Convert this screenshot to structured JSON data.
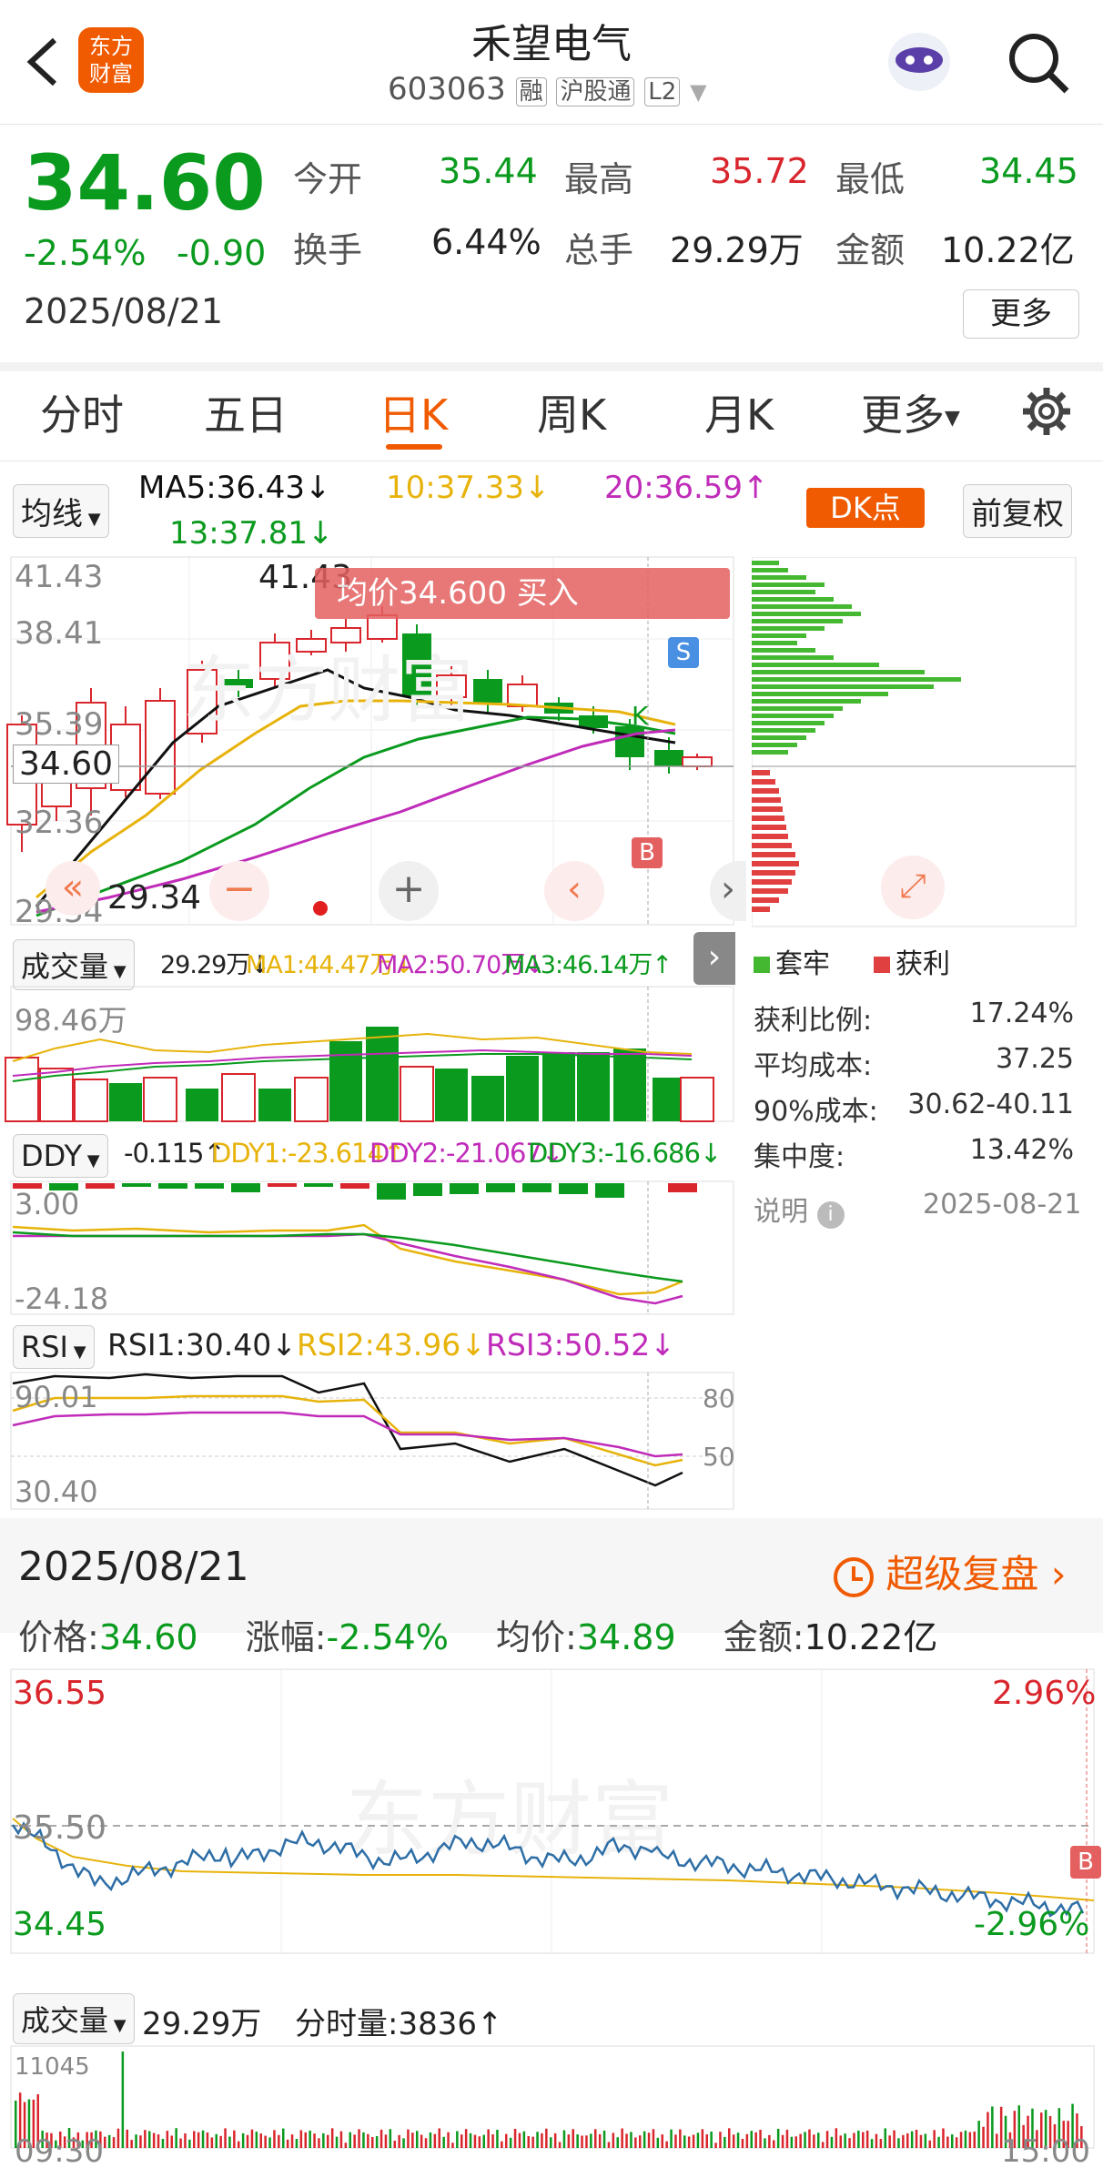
{
  "header": {
    "stock_name": "禾望电气",
    "code": "603063",
    "badges": [
      "融",
      "沪股通",
      "L2"
    ],
    "logo_line1": "东方",
    "logo_line2": "财富"
  },
  "quote": {
    "price": "34.60",
    "pct": "-2.54%",
    "change": "-0.90",
    "date": "2025/08/21",
    "open_label": "今开",
    "open": "35.44",
    "high_label": "最高",
    "high": "35.72",
    "low_label": "最低",
    "low": "34.45",
    "turnover_label": "换手",
    "turnover": "6.44%",
    "volume_label": "总手",
    "volume": "29.29万",
    "amount_label": "金额",
    "amount": "10.22亿",
    "more": "更多"
  },
  "tabs": [
    "分时",
    "五日",
    "日K",
    "周K",
    "月K",
    "更多"
  ],
  "kline": {
    "ma_select": "均线",
    "ma5": "MA5:36.43↓",
    "ma10": "10:37.33↓",
    "ma20": "20:36.59↑",
    "ma13": "13:37.81↓",
    "dk": "DK点",
    "adjust": "前复权",
    "axis": [
      "41.43",
      "38.41",
      "35.39",
      "32.36",
      "29.34"
    ],
    "current_price": "34.60",
    "max_label": "41.43",
    "min_label": "29.34",
    "avg_banner": "均价34.600  买入",
    "signal_s": "S",
    "signal_b": "B",
    "signal_k": "K"
  },
  "volume_panel": {
    "select": "成交量",
    "v": "29.29万↓",
    "ma1": "MA1:44.47万↓",
    "ma2": "MA2:50.70万↓",
    "ma3": "MA3:46.14万↑",
    "axis_top": "98.46万"
  },
  "ddy_panel": {
    "select": "DDY",
    "v": "-0.115↑",
    "ddy1": "DDY1:-23.614↑",
    "ddy2": "DDY2:-21.067↓",
    "ddy3": "DDY3:-16.686↓",
    "axis_top": "3.00",
    "axis_bottom": "-24.18"
  },
  "rsi_panel": {
    "select": "RSI",
    "rsi1": "RSI1:30.40↓",
    "rsi2": "RSI2:43.96↓",
    "rsi3": "RSI3:50.52↓",
    "axis_top": "90.01",
    "axis_bottom": "30.40",
    "level_80": "80",
    "level_50": "50"
  },
  "cost": {
    "legend_trapped": "套牢",
    "legend_profit": "获利",
    "rows": [
      {
        "label": "获利比例:",
        "value": "17.24%"
      },
      {
        "label": "平均成本:",
        "value": "37.25"
      },
      {
        "label": "90%成本:",
        "value": "30.62-40.11"
      },
      {
        "label": "集中度:",
        "value": "13.42%"
      }
    ],
    "note": "说明",
    "date": "2025-08-21"
  },
  "intraday": {
    "date": "2025/08/21",
    "super_review": "超级复盘",
    "price_label": "价格:",
    "price": "34.60",
    "pct_label": "涨幅:",
    "pct": "-2.54%",
    "avg_label": "均价:",
    "avg": "34.89",
    "amount_label": "金额:",
    "amount": "10.22亿",
    "y_top": "36.55",
    "y_mid": "35.50",
    "y_bottom": "34.45",
    "pct_top": "2.96%",
    "pct_bottom": "-2.96%",
    "signal_b": "B",
    "vol_select": "成交量",
    "vol_total": "29.29万",
    "vol_minute_label": "分时量:",
    "vol_minute": "3836↑",
    "vol_axis": "11045",
    "time_start": "09:30",
    "time_end": "15:00"
  },
  "watermark": "东方财富",
  "colors": {
    "up": "#d9262d",
    "down": "#0a9a1e",
    "accent": "#f05a00",
    "ma5": "#111111",
    "ma10": "#e7b30b",
    "ma20": "#c02bb9",
    "ma13": "#0a9a1e",
    "intraday_line": "#2e6ea6",
    "avg_line": "#e7b30b"
  }
}
